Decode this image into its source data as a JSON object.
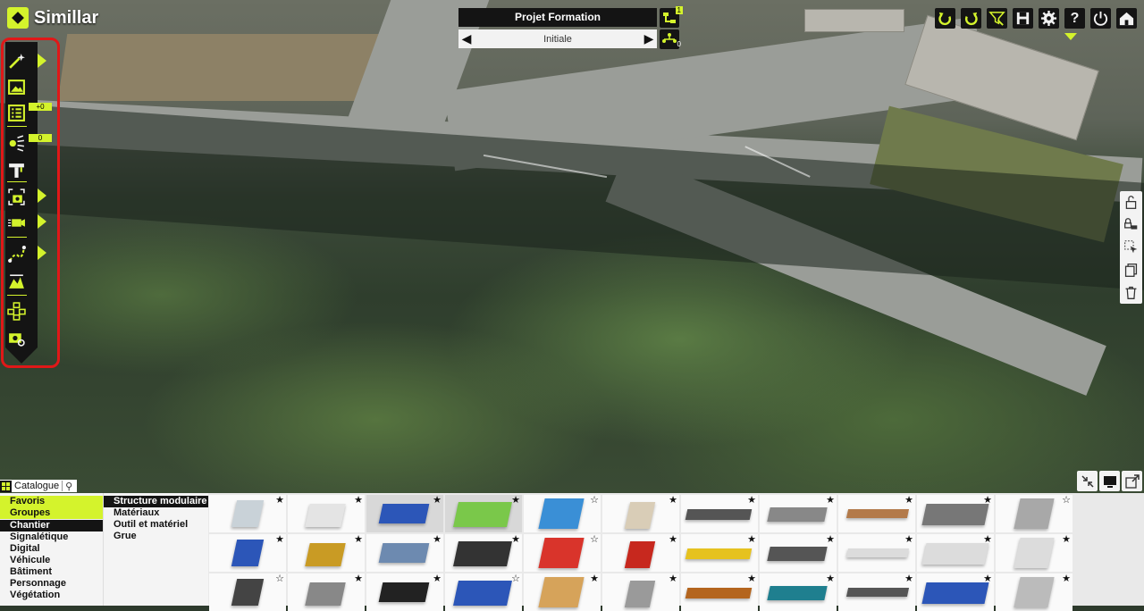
{
  "app": {
    "name": "Simillar"
  },
  "project": {
    "title": "Projet Formation",
    "variant": "Initiale",
    "variant_badge": "1",
    "node_badge": "0"
  },
  "top_tools": [
    {
      "icon": "undo-icon"
    },
    {
      "icon": "redo-icon"
    },
    {
      "icon": "filter-link-icon"
    },
    {
      "icon": "save-icon"
    },
    {
      "icon": "gear-icon"
    },
    {
      "icon": "help-icon",
      "label": "?"
    },
    {
      "icon": "power-icon"
    },
    {
      "icon": "home-icon"
    }
  ],
  "left_tools": {
    "badges": {
      "list": "+0",
      "lights": "0"
    },
    "items": [
      "magic-wand-icon",
      "image-icon",
      "checklist-icon",
      "light-source-icon",
      "crane-icon",
      "camera-frame-icon",
      "video-camera-icon",
      "path-icon",
      "terrain-icon",
      "network-icon",
      "camera-settings-icon"
    ]
  },
  "right_tools": [
    "unlock-icon",
    "lock-vehicle-icon",
    "select-cursor-icon",
    "copy-icon",
    "trash-icon"
  ],
  "catalog": {
    "tab_label": "Catalogue",
    "categories": {
      "favorites": "Favoris",
      "groups": "Groupes",
      "items": [
        "Chantier",
        "Signalétique",
        "Digital",
        "Véhicule",
        "Bâtiment",
        "Personnage",
        "Végétation"
      ],
      "selected": "Chantier"
    },
    "subcategories": {
      "items": [
        "Structure modulaire",
        "Matériaux",
        "Outil et matériel",
        "Grue"
      ],
      "selected": "Structure modulaire"
    },
    "thumbs": [
      {
        "name": "module-office",
        "color": "#c9d2d8"
      },
      {
        "name": "container-white",
        "color": "#e4e4e4"
      },
      {
        "name": "blue-tank",
        "color": "#2c56b8"
      },
      {
        "name": "green-skip",
        "color": "#7ac84a"
      },
      {
        "name": "bus-shelter",
        "color": "#3a8fd6"
      },
      {
        "name": "round-tank",
        "color": "#d9cdb7"
      },
      {
        "name": "rail-track",
        "color": "#555555"
      },
      {
        "name": "fence-panel",
        "color": "#888888"
      },
      {
        "name": "barrier-long",
        "color": "#b37a4a"
      },
      {
        "name": "scaffold",
        "color": "#777777"
      },
      {
        "name": "pipe-frame",
        "color": "#a8a8a8"
      },
      {
        "name": "conveyor-blue",
        "color": "#2c56b8"
      },
      {
        "name": "yellow-skip",
        "color": "#c99b24"
      },
      {
        "name": "rail-cart",
        "color": "#6d8ab0"
      },
      {
        "name": "frame-table",
        "color": "#333333"
      },
      {
        "name": "windsock",
        "color": "#d9342b"
      },
      {
        "name": "scissor-lift",
        "color": "#c7281e"
      },
      {
        "name": "yellow-ramp",
        "color": "#e6c21f"
      },
      {
        "name": "cabinet-dark",
        "color": "#555555"
      },
      {
        "name": "concrete-barrier",
        "color": "#dcdcdc"
      },
      {
        "name": "concrete-barrier-2",
        "color": "#dcdcdc"
      },
      {
        "name": "concrete-barrier-3",
        "color": "#dcdcdc"
      },
      {
        "name": "manhole-square",
        "color": "#444444"
      },
      {
        "name": "manhole-round",
        "color": "#888888"
      },
      {
        "name": "round-lid",
        "color": "#222222"
      },
      {
        "name": "blue-lockers",
        "color": "#2c56b8"
      },
      {
        "name": "wooden-table",
        "color": "#d6a35a"
      },
      {
        "name": "gray-container",
        "color": "#9a9a9a"
      },
      {
        "name": "wooden-crate",
        "color": "#b4651e"
      },
      {
        "name": "teal-container",
        "color": "#1f7f8f"
      },
      {
        "name": "steel-plate",
        "color": "#555555"
      },
      {
        "name": "blue-scaffold",
        "color": "#2c56b8"
      },
      {
        "name": "grating",
        "color": "#bbbbbb"
      }
    ],
    "stars": {
      "filled": "★",
      "empty": "☆"
    }
  }
}
